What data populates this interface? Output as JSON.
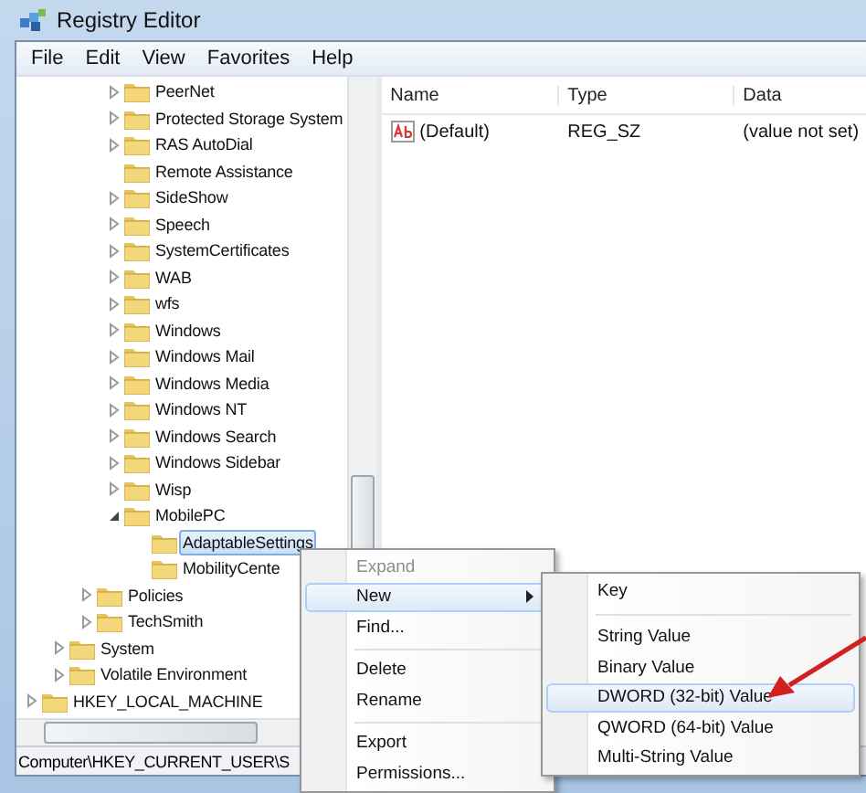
{
  "window": {
    "title": "Registry Editor"
  },
  "menu_bar": [
    "File",
    "Edit",
    "View",
    "Favorites",
    "Help"
  ],
  "tree": [
    {
      "children": [
        {
          "children": [
            {
              "children": [
                {
                  "label": "PeerNet",
                  "expandable": true,
                  "expanded": false,
                  "selected": false
                },
                {
                  "label": "Protected Storage System",
                  "expandable": true,
                  "expanded": false,
                  "selected": false
                },
                {
                  "label": "RAS AutoDial",
                  "expandable": true,
                  "expanded": false,
                  "selected": false
                },
                {
                  "label": "Remote Assistance",
                  "expandable": false,
                  "selected": false
                },
                {
                  "label": "SideShow",
                  "expandable": true,
                  "expanded": false,
                  "selected": false
                },
                {
                  "label": "Speech",
                  "expandable": true,
                  "expanded": false,
                  "selected": false
                },
                {
                  "label": "SystemCertificates",
                  "expandable": true,
                  "expanded": false,
                  "selected": false
                },
                {
                  "label": "WAB",
                  "expandable": true,
                  "expanded": false,
                  "selected": false
                },
                {
                  "label": "wfs",
                  "expandable": true,
                  "expanded": false,
                  "selected": false
                },
                {
                  "label": "Windows",
                  "expandable": true,
                  "expanded": false,
                  "selected": false
                },
                {
                  "label": "Windows Mail",
                  "expandable": true,
                  "expanded": false,
                  "selected": false
                },
                {
                  "label": "Windows Media",
                  "expandable": true,
                  "expanded": false,
                  "selected": false
                },
                {
                  "label": "Windows NT",
                  "expandable": true,
                  "expanded": false,
                  "selected": false
                },
                {
                  "label": "Windows Search",
                  "expandable": true,
                  "expanded": false,
                  "selected": false
                },
                {
                  "label": "Windows Sidebar",
                  "expandable": true,
                  "expanded": false,
                  "selected": false
                },
                {
                  "label": "Wisp",
                  "expandable": true,
                  "expanded": false,
                  "selected": false
                },
                {
                  "label": "MobilePC",
                  "expandable": true,
                  "expanded": true,
                  "selected": false,
                  "children": [
                    {
                      "label": "AdaptableSettings",
                      "expandable": false,
                      "selected": true
                    },
                    {
                      "label": "MobilityCente",
                      "expandable": false,
                      "selected": false
                    }
                  ]
                }
              ]
            },
            {
              "label": "Policies",
              "expandable": true,
              "expanded": false,
              "selected": false
            },
            {
              "label": "TechSmith",
              "expandable": true,
              "expanded": false,
              "selected": false
            }
          ]
        },
        {
          "label": "System",
          "expandable": true,
          "expanded": false,
          "selected": false
        },
        {
          "label": "Volatile Environment",
          "expandable": true,
          "expanded": false,
          "selected": false
        }
      ]
    },
    {
      "label": "HKEY_LOCAL_MACHINE",
      "expandable": true,
      "expanded": false,
      "selected": false
    }
  ],
  "list": {
    "columns": [
      "Name",
      "Type",
      "Data"
    ],
    "rows": [
      {
        "name": "(Default)",
        "type": "REG_SZ",
        "data": "(value not set)"
      }
    ]
  },
  "status_bar": "Computer\\HKEY_CURRENT_USER\\S",
  "context_menu": [
    {
      "kind": "item",
      "label": "Expand",
      "disabled": true,
      "selected": false,
      "submenu": false
    },
    {
      "kind": "item",
      "label": "New",
      "disabled": false,
      "selected": true,
      "submenu": true
    },
    {
      "kind": "item",
      "label": "Find...",
      "disabled": false,
      "selected": false,
      "submenu": false
    },
    {
      "kind": "separator"
    },
    {
      "kind": "item",
      "label": "Delete",
      "disabled": false,
      "selected": false,
      "submenu": false
    },
    {
      "kind": "item",
      "label": "Rename",
      "disabled": false,
      "selected": false,
      "submenu": false
    },
    {
      "kind": "separator"
    },
    {
      "kind": "item",
      "label": "Export",
      "disabled": false,
      "selected": false,
      "submenu": false
    },
    {
      "kind": "item",
      "label": "Permissions...",
      "disabled": false,
      "selected": false,
      "submenu": false
    }
  ],
  "submenu": [
    {
      "kind": "item",
      "label": "Key",
      "selected": false
    },
    {
      "kind": "separator"
    },
    {
      "kind": "item",
      "label": "String Value",
      "selected": false
    },
    {
      "kind": "item",
      "label": "Binary Value",
      "selected": false
    },
    {
      "kind": "item",
      "label": "DWORD (32-bit) Value",
      "selected": true
    },
    {
      "kind": "item",
      "label": "QWORD (64-bit) Value",
      "selected": false
    },
    {
      "kind": "item",
      "label": "Multi-String Value",
      "selected": false
    }
  ]
}
